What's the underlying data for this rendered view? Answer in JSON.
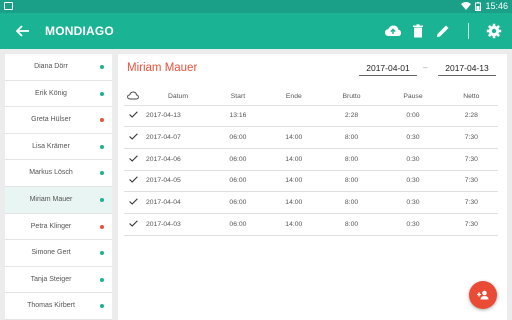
{
  "status_bar": {
    "time": "15:46"
  },
  "app_bar": {
    "title": "MONDIAGO",
    "icons": [
      "back-arrow-icon",
      "cloud-upload-icon",
      "trash-icon",
      "edit-pencil-icon",
      "settings-gear-icon"
    ]
  },
  "sidebar": {
    "items": [
      {
        "name": "Diana Dörr",
        "status": "green"
      },
      {
        "name": "Erik König",
        "status": "green"
      },
      {
        "name": "Greta Hülser",
        "status": "red"
      },
      {
        "name": "Lisa Krämer",
        "status": "green"
      },
      {
        "name": "Markus Lösch",
        "status": "green"
      },
      {
        "name": "Miriam Mauer",
        "status": "green"
      },
      {
        "name": "Petra Klinger",
        "status": "red"
      },
      {
        "name": "Simone Gert",
        "status": "green"
      },
      {
        "name": "Tanja Steiger",
        "status": "green"
      },
      {
        "name": "Thomas Kirbert",
        "status": "green"
      }
    ],
    "active_index": 5,
    "status_colors": {
      "green": "#1ab394",
      "red": "#e5533d"
    }
  },
  "detail": {
    "employee_name": "Miriam Mauer",
    "date_from": "2017-04-01",
    "date_separator": "–",
    "date_to": "2017-04-13",
    "table": {
      "headers": [
        "Datum",
        "Start",
        "Ende",
        "Brutto",
        "Pause",
        "Netto"
      ],
      "rows": [
        {
          "datum": "2017-04-13",
          "start": "13:16",
          "ende": "",
          "brutto": "2:28",
          "pause": "0:00",
          "netto": "2:28"
        },
        {
          "datum": "2017-04-07",
          "start": "06:00",
          "ende": "14:00",
          "brutto": "8:00",
          "pause": "0:30",
          "netto": "7:30"
        },
        {
          "datum": "2017-04-06",
          "start": "06:00",
          "ende": "14:00",
          "brutto": "8:00",
          "pause": "0:30",
          "netto": "7:30"
        },
        {
          "datum": "2017-04-05",
          "start": "06:00",
          "ende": "14:00",
          "brutto": "8:00",
          "pause": "0:30",
          "netto": "7:30"
        },
        {
          "datum": "2017-04-04",
          "start": "06:00",
          "ende": "14:00",
          "brutto": "8:00",
          "pause": "0:30",
          "netto": "7:30"
        },
        {
          "datum": "2017-04-03",
          "start": "06:00",
          "ende": "14:00",
          "brutto": "8:00",
          "pause": "0:30",
          "netto": "7:30"
        }
      ]
    }
  },
  "fab": {
    "icon": "add-group-icon",
    "color": "#ea4b35"
  },
  "colors": {
    "accent": "#1ab394",
    "status_bar": "#1aa088",
    "name_red": "#e5533d"
  }
}
